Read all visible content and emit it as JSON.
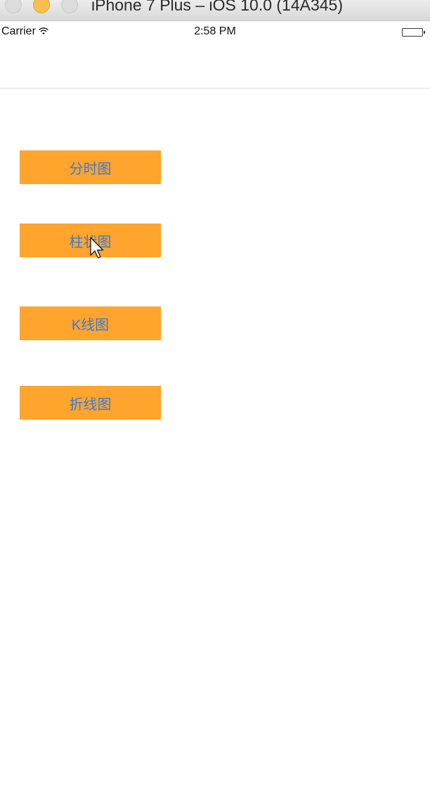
{
  "window": {
    "title": "iPhone 7 Plus – iOS 10.0 (14A345)"
  },
  "status_bar": {
    "carrier": "Carrier",
    "time": "2:58 PM",
    "wifi_icon": "wifi-icon",
    "battery_icon": "battery-icon"
  },
  "buttons": [
    {
      "label": "分时图"
    },
    {
      "label": "柱状图"
    },
    {
      "label": "K线图"
    },
    {
      "label": "折线图"
    }
  ],
  "colors": {
    "button_bg": "#ffa42d",
    "button_text": "#3a7bd5"
  }
}
